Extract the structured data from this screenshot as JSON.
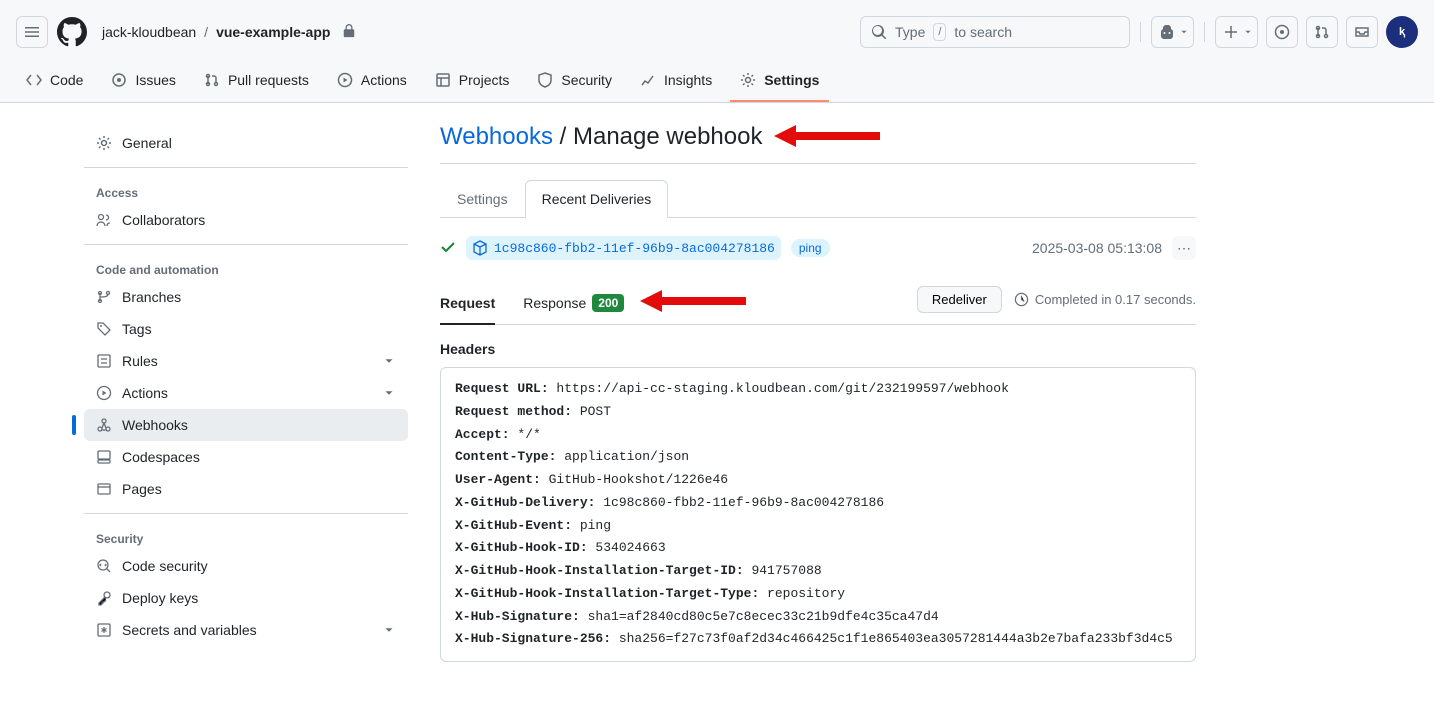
{
  "breadcrumb": {
    "owner": "jack-kloudbean",
    "repo": "vue-example-app"
  },
  "search": {
    "prefix": "Type",
    "kbd": "/",
    "suffix": "to search"
  },
  "tabs": {
    "code": "Code",
    "issues": "Issues",
    "pulls": "Pull requests",
    "actions": "Actions",
    "projects": "Projects",
    "security": "Security",
    "insights": "Insights",
    "settings": "Settings"
  },
  "sidebar": {
    "general": "General",
    "access_heading": "Access",
    "collaborators": "Collaborators",
    "code_heading": "Code and automation",
    "branches": "Branches",
    "tags": "Tags",
    "rules": "Rules",
    "actions": "Actions",
    "webhooks": "Webhooks",
    "codespaces": "Codespaces",
    "pages": "Pages",
    "security_heading": "Security",
    "code_security": "Code security",
    "deploy_keys": "Deploy keys",
    "secrets": "Secrets and variables"
  },
  "page": {
    "webhooks_link": "Webhooks",
    "slash": "/",
    "title": "Manage webhook",
    "tab_settings": "Settings",
    "tab_deliveries": "Recent Deliveries"
  },
  "delivery": {
    "id": "1c98c860-fbb2-11ef-96b9-8ac004278186",
    "event": "ping",
    "time": "2025-03-08 05:13:08"
  },
  "reqresp": {
    "request": "Request",
    "response": "Response",
    "status": "200",
    "redeliver": "Redeliver",
    "completed": "Completed in 0.17 seconds."
  },
  "headers_title": "Headers",
  "headers": [
    {
      "k": "Request URL:",
      "v": "https://api-cc-staging.kloudbean.com/git/232199597/webhook"
    },
    {
      "k": "Request method:",
      "v": "POST"
    },
    {
      "k": "Accept:",
      "v": "*/*"
    },
    {
      "k": "Content-Type:",
      "v": "application/json"
    },
    {
      "k": "User-Agent:",
      "v": "GitHub-Hookshot/1226e46"
    },
    {
      "k": "X-GitHub-Delivery:",
      "v": "1c98c860-fbb2-11ef-96b9-8ac004278186"
    },
    {
      "k": "X-GitHub-Event:",
      "v": "ping"
    },
    {
      "k": "X-GitHub-Hook-ID:",
      "v": "534024663"
    },
    {
      "k": "X-GitHub-Hook-Installation-Target-ID:",
      "v": "941757088"
    },
    {
      "k": "X-GitHub-Hook-Installation-Target-Type:",
      "v": "repository"
    },
    {
      "k": "X-Hub-Signature:",
      "v": "sha1=af2840cd80c5e7c8ecec33c21b9dfe4c35ca47d4"
    },
    {
      "k": "X-Hub-Signature-256:",
      "v": "sha256=f27c73f0af2d34c466425c1f1e865403ea3057281444a3b2e7bafa233bf3d4c5"
    }
  ]
}
